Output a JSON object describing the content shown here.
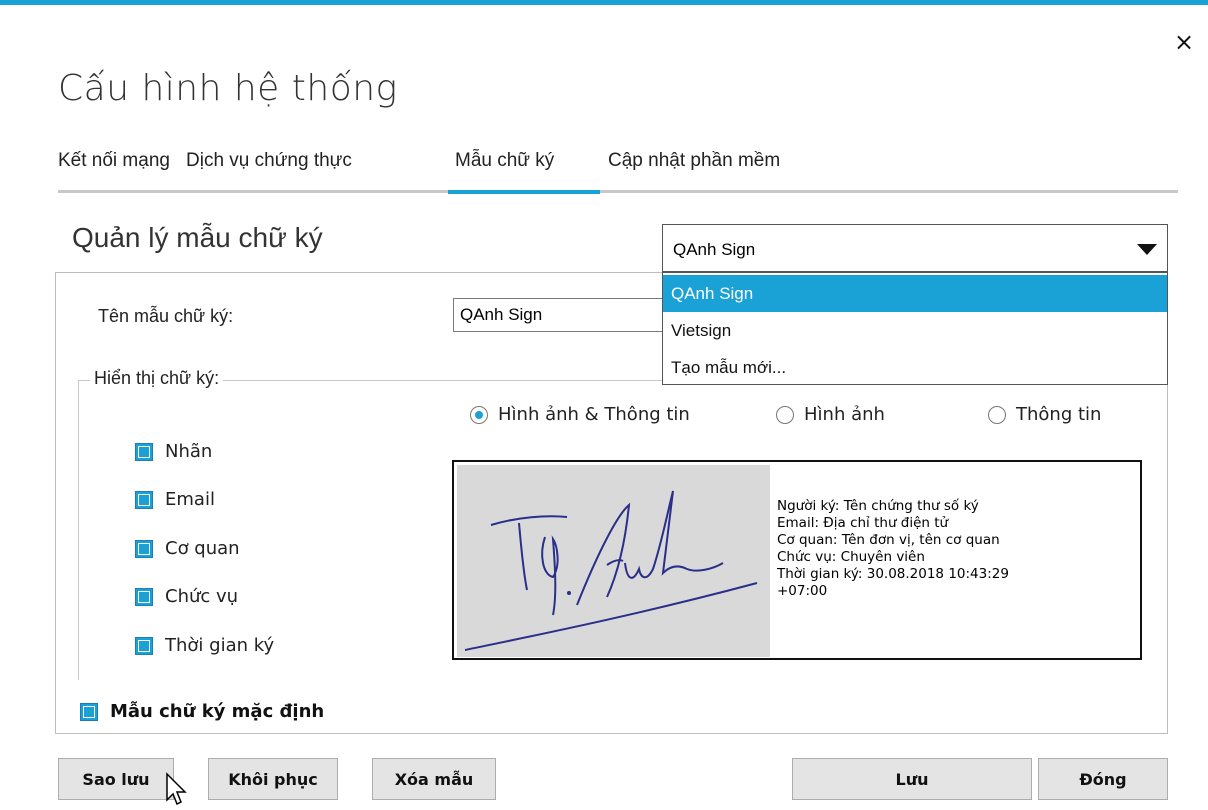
{
  "dialog": {
    "title": "Cấu hình hệ thống",
    "close_symbol": "×",
    "accent_color": "#1aa1d6"
  },
  "tabs": [
    {
      "label": "Kết nối mạng",
      "active": false
    },
    {
      "label": "Dịch vụ chứng thực",
      "active": false
    },
    {
      "label": "Mẫu chữ ký",
      "active": true
    },
    {
      "label": "Cập nhật phần mềm",
      "active": false
    }
  ],
  "section": {
    "title": "Quản lý mẫu chữ ký"
  },
  "template_select": {
    "selected": "QAnh Sign",
    "options": [
      "QAnh Sign",
      "Vietsign",
      "Tạo mẫu mới..."
    ],
    "highlighted_index": 0
  },
  "form": {
    "name_label": "Tên mẫu chữ ký:",
    "name_value": "QAnh Sign",
    "display_group_label": "Hiển thị chữ ký:",
    "display_mode": {
      "options": [
        "Hình ảnh & Thông tin",
        "Hình ảnh",
        "Thông tin"
      ],
      "selected_index": 0
    },
    "fields": [
      {
        "label": "Nhãn",
        "checked": true
      },
      {
        "label": "Email",
        "checked": true
      },
      {
        "label": "Cơ quan",
        "checked": true
      },
      {
        "label": "Chức vụ",
        "checked": true
      },
      {
        "label": "Thời gian ký",
        "checked": true
      }
    ],
    "default_label": "Mẫu chữ ký mặc định",
    "default_checked": true
  },
  "preview": {
    "lines": [
      "Người ký: Tên chứng thư số ký",
      "Email: Địa chỉ thư điện tử",
      "Cơ quan: Tên đơn vị, tên cơ quan",
      "Chức vụ: Chuyên viên",
      "Thời gian ký: 30.08.2018 10:43:29",
      "+07:00"
    ]
  },
  "buttons": {
    "backup": "Sao lưu",
    "restore": "Khôi phục",
    "delete": "Xóa mẫu",
    "save": "Lưu",
    "close": "Đóng"
  }
}
